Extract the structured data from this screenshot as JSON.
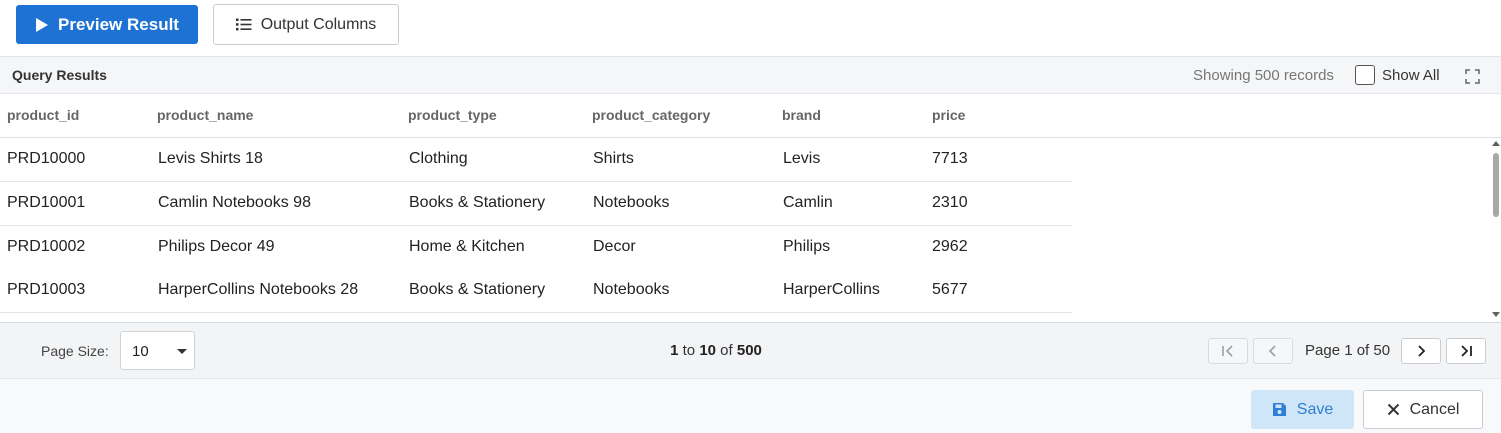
{
  "toolbar": {
    "preview_label": "Preview Result",
    "output_columns_label": "Output Columns",
    "preview_icon": "play-icon",
    "output_columns_icon": "list-icon"
  },
  "results": {
    "title": "Query Results",
    "records_text": "Showing 500 records",
    "show_all_label": "Show All",
    "show_all_checked": false,
    "expand_icon": "fullscreen-icon"
  },
  "grid": {
    "columns": [
      "product_id",
      "product_name",
      "product_type",
      "product_category",
      "brand",
      "price"
    ],
    "rows": [
      [
        "PRD10000",
        "Levis Shirts 18",
        "Clothing",
        "Shirts",
        "Levis",
        "7713"
      ],
      [
        "PRD10001",
        "Camlin Notebooks 98",
        "Books & Stationery",
        "Notebooks",
        "Camlin",
        "2310"
      ],
      [
        "PRD10002",
        "Philips Decor 49",
        "Home & Kitchen",
        "Decor",
        "Philips",
        "2962"
      ],
      [
        "PRD10003",
        "HarperCollins Notebooks 28",
        "Books & Stationery",
        "Notebooks",
        "HarperCollins",
        "5677"
      ]
    ]
  },
  "pager": {
    "page_size_label": "Page Size:",
    "page_size_value": "10",
    "range_from": "1",
    "range_to_word": "to",
    "range_to": "10",
    "range_of_word": "of",
    "range_total": "500",
    "page_info": "Page 1 of 50",
    "first_icon": "first-page-icon",
    "prev_icon": "prev-page-icon",
    "next_icon": "next-page-icon",
    "last_icon": "last-page-icon"
  },
  "footer": {
    "save_label": "Save",
    "cancel_label": "Cancel",
    "save_icon": "floppy-disk-icon",
    "cancel_icon": "close-icon"
  },
  "colors": {
    "primary": "#1e72d4",
    "save_bg": "#cfe6f8",
    "save_text": "#2f7fd4"
  }
}
